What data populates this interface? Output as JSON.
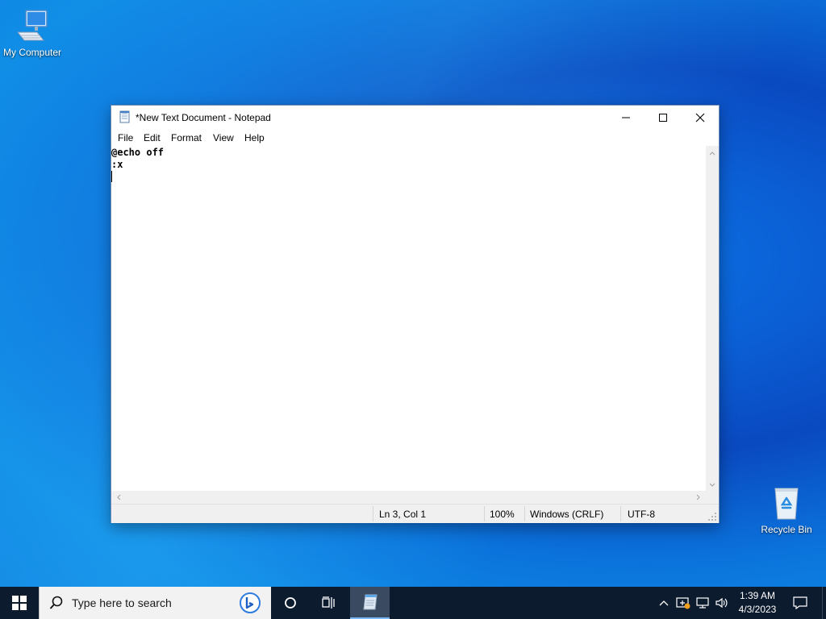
{
  "desktop": {
    "icons": [
      {
        "label": "My Computer",
        "icon": "computer-icon"
      },
      {
        "label": "Recycle Bin",
        "icon": "recycle-bin-icon"
      }
    ]
  },
  "notepad": {
    "title": "*New Text Document - Notepad",
    "menu": [
      "File",
      "Edit",
      "Format",
      "View",
      "Help"
    ],
    "content_lines": [
      "@echo off",
      ":x",
      ""
    ],
    "status": {
      "position": "Ln 3, Col 1",
      "zoom": "100%",
      "line_ending": "Windows (CRLF)",
      "encoding": "UTF-8"
    }
  },
  "taskbar": {
    "search_placeholder": "Type here to search",
    "clock_time": "1:39 AM",
    "clock_date": "4/3/2023"
  },
  "colors": {
    "taskbar_bg": "#0d1b2e",
    "desktop_blue": "#0a6fe0"
  }
}
